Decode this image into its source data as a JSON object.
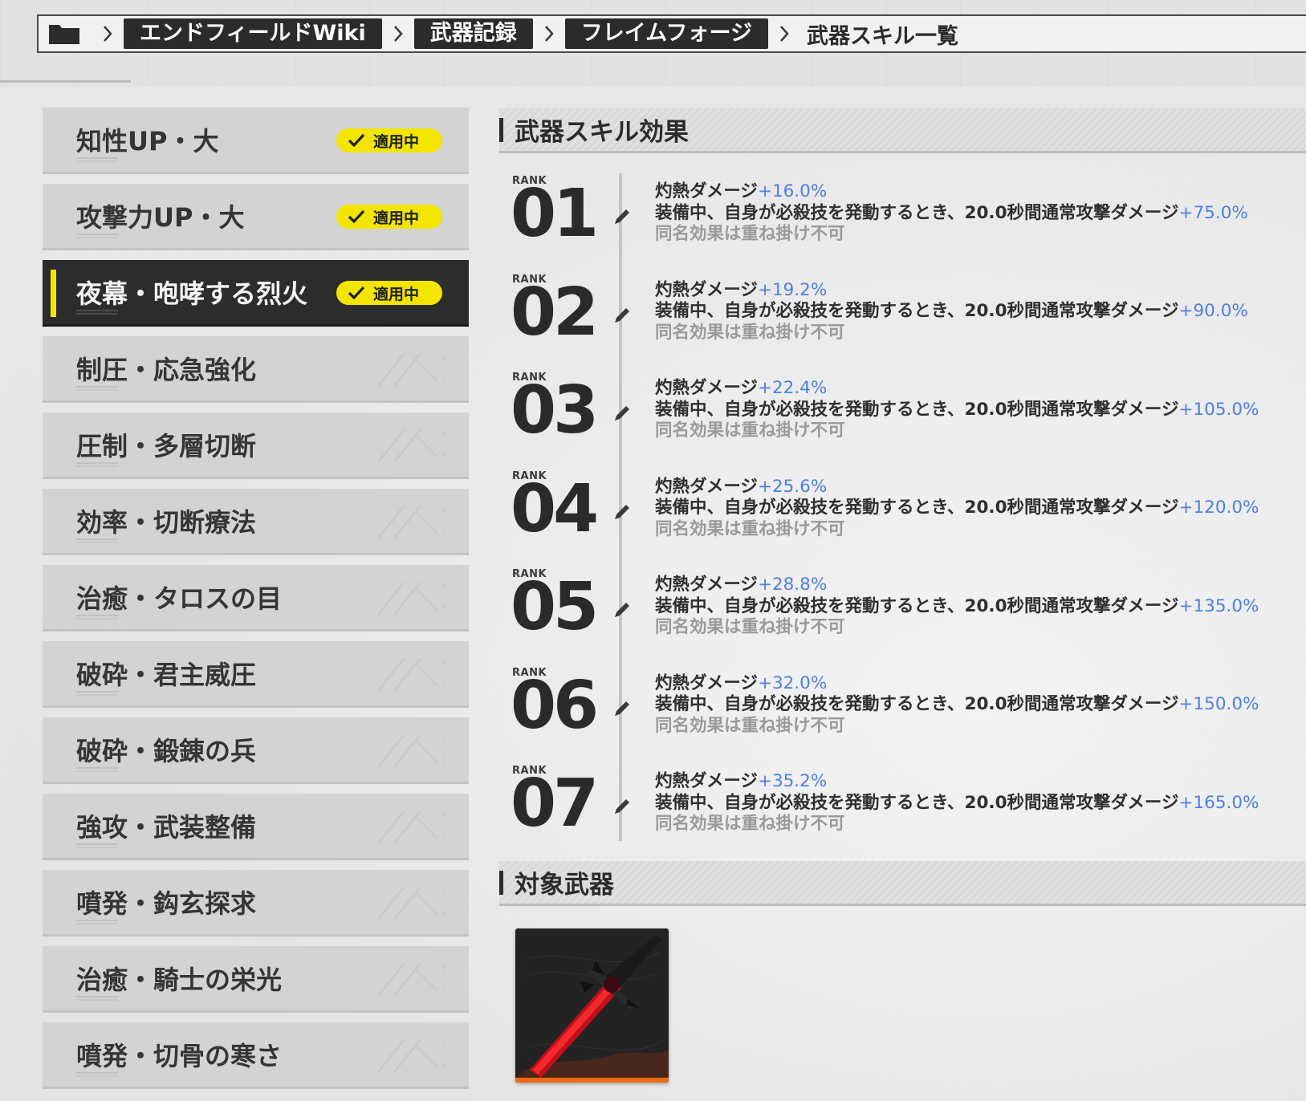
{
  "breadcrumb": {
    "items": [
      "エンドフィールドWiki",
      "武器記録",
      "フレイムフォージ"
    ],
    "current": "武器スキル一覧"
  },
  "sidebar": {
    "applied_label": "適用中",
    "items": [
      {
        "label": "知性UP・大",
        "applied": true,
        "active": false
      },
      {
        "label": "攻撃力UP・大",
        "applied": true,
        "active": false
      },
      {
        "label": "夜幕・咆哮する烈火",
        "applied": true,
        "active": true
      },
      {
        "label": "制圧・応急強化",
        "applied": false,
        "active": false
      },
      {
        "label": "圧制・多層切断",
        "applied": false,
        "active": false
      },
      {
        "label": "効率・切断療法",
        "applied": false,
        "active": false
      },
      {
        "label": "治癒・タロスの目",
        "applied": false,
        "active": false
      },
      {
        "label": "破砕・君主威圧",
        "applied": false,
        "active": false
      },
      {
        "label": "破砕・鍛錬の兵",
        "applied": false,
        "active": false
      },
      {
        "label": "強攻・武装整備",
        "applied": false,
        "active": false
      },
      {
        "label": "噴発・鈎玄探求",
        "applied": false,
        "active": false
      },
      {
        "label": "治癒・騎士の栄光",
        "applied": false,
        "active": false
      },
      {
        "label": "噴発・切骨の寒さ",
        "applied": false,
        "active": false
      }
    ]
  },
  "effects": {
    "title": "武器スキル効果",
    "rank_word": "RANK",
    "ranks": [
      {
        "num": "01",
        "line1_text": "灼熱ダメージ",
        "line1_value": "+16.0%",
        "line2_text": "装備中、自身が必殺技を発動するとき、20.0秒間通常攻撃ダメージ",
        "line2_value": "+75.0%",
        "line3": "同名効果は重ね掛け不可"
      },
      {
        "num": "02",
        "line1_text": "灼熱ダメージ",
        "line1_value": "+19.2%",
        "line2_text": "装備中、自身が必殺技を発動するとき、20.0秒間通常攻撃ダメージ",
        "line2_value": "+90.0%",
        "line3": "同名効果は重ね掛け不可"
      },
      {
        "num": "03",
        "line1_text": "灼熱ダメージ",
        "line1_value": "+22.4%",
        "line2_text": "装備中、自身が必殺技を発動するとき、20.0秒間通常攻撃ダメージ",
        "line2_value": "+105.0%",
        "line3": "同名効果は重ね掛け不可"
      },
      {
        "num": "04",
        "line1_text": "灼熱ダメージ",
        "line1_value": "+25.6%",
        "line2_text": "装備中、自身が必殺技を発動するとき、20.0秒間通常攻撃ダメージ",
        "line2_value": "+120.0%",
        "line3": "同名効果は重ね掛け不可"
      },
      {
        "num": "05",
        "line1_text": "灼熱ダメージ",
        "line1_value": "+28.8%",
        "line2_text": "装備中、自身が必殺技を発動するとき、20.0秒間通常攻撃ダメージ",
        "line2_value": "+135.0%",
        "line3": "同名効果は重ね掛け不可"
      },
      {
        "num": "06",
        "line1_text": "灼熱ダメージ",
        "line1_value": "+32.0%",
        "line2_text": "装備中、自身が必殺技を発動するとき、20.0秒間通常攻撃ダメージ",
        "line2_value": "+150.0%",
        "line3": "同名効果は重ね掛け不可"
      },
      {
        "num": "07",
        "line1_text": "灼熱ダメージ",
        "line1_value": "+35.2%",
        "line2_text": "装備中、自身が必殺技を発動するとき、20.0秒間通常攻撃ダメージ",
        "line2_value": "+165.0%",
        "line3": "同名効果は重ね掛け不可"
      }
    ]
  },
  "target_weapons": {
    "title": "対象武器",
    "weapons": [
      {
        "icon": "red-greatsword-icon",
        "rarity_color": "#ef6a10"
      }
    ]
  },
  "colors": {
    "accent_yellow": "#f2e600",
    "value_blue": "#4f7fe0",
    "dark": "#2b2b2b"
  }
}
